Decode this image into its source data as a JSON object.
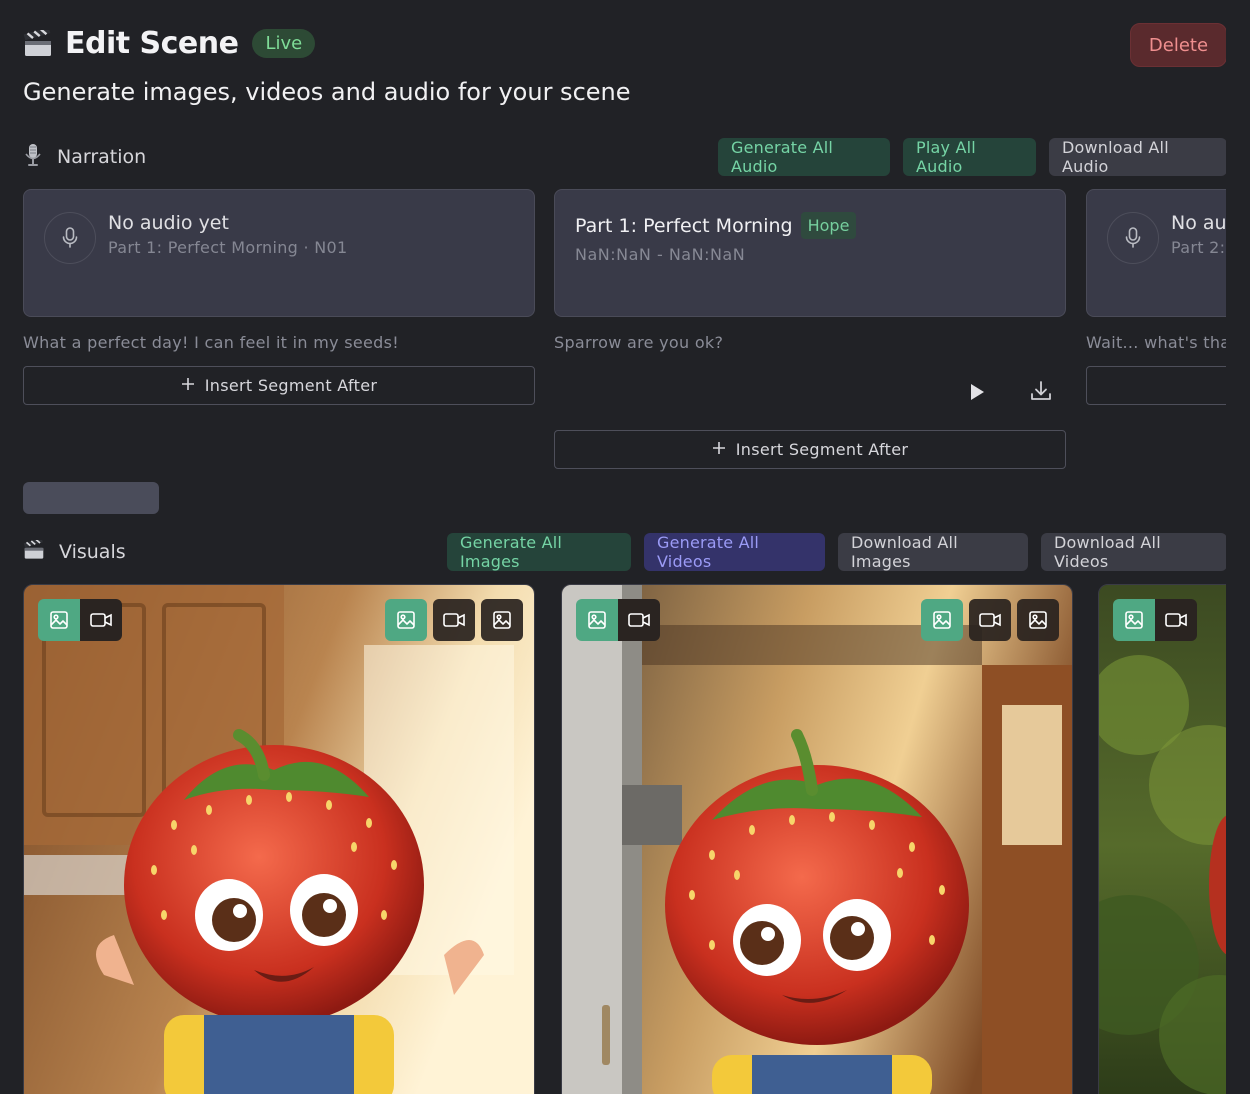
{
  "header": {
    "title": "Edit Scene",
    "status": "Live",
    "delete_label": "Delete",
    "subtitle": "Generate images, videos and audio for your scene"
  },
  "narration": {
    "label": "Narration",
    "actions": {
      "generate_all": "Generate All Audio",
      "play_all": "Play All Audio",
      "download_all": "Download All Audio"
    },
    "segments": [
      {
        "title": "No audio yet",
        "subtitle": "Part 1: Perfect Morning · N01",
        "caption": "What a perfect day! I can feel it in my seeds!",
        "insert_label": "Insert Segment After"
      },
      {
        "title": "Part 1: Perfect Morning",
        "voice": "Hope",
        "time": "NaN:NaN - NaN:NaN",
        "caption": "Sparrow are you ok?",
        "insert_label": "Insert Segment After"
      },
      {
        "title": "No audio yet",
        "subtitle": "Part 2:",
        "caption": "Wait... what's that"
      }
    ]
  },
  "visuals": {
    "label": "Visuals",
    "actions": {
      "generate_images": "Generate All Images",
      "generate_videos": "Generate All Videos",
      "download_images": "Download All Images",
      "download_videos": "Download All Videos"
    }
  },
  "colors": {
    "background": "#212226",
    "accent_green": "#4fa883",
    "accent_purple": "#9b9bf6",
    "danger": "#ef8f8f"
  }
}
